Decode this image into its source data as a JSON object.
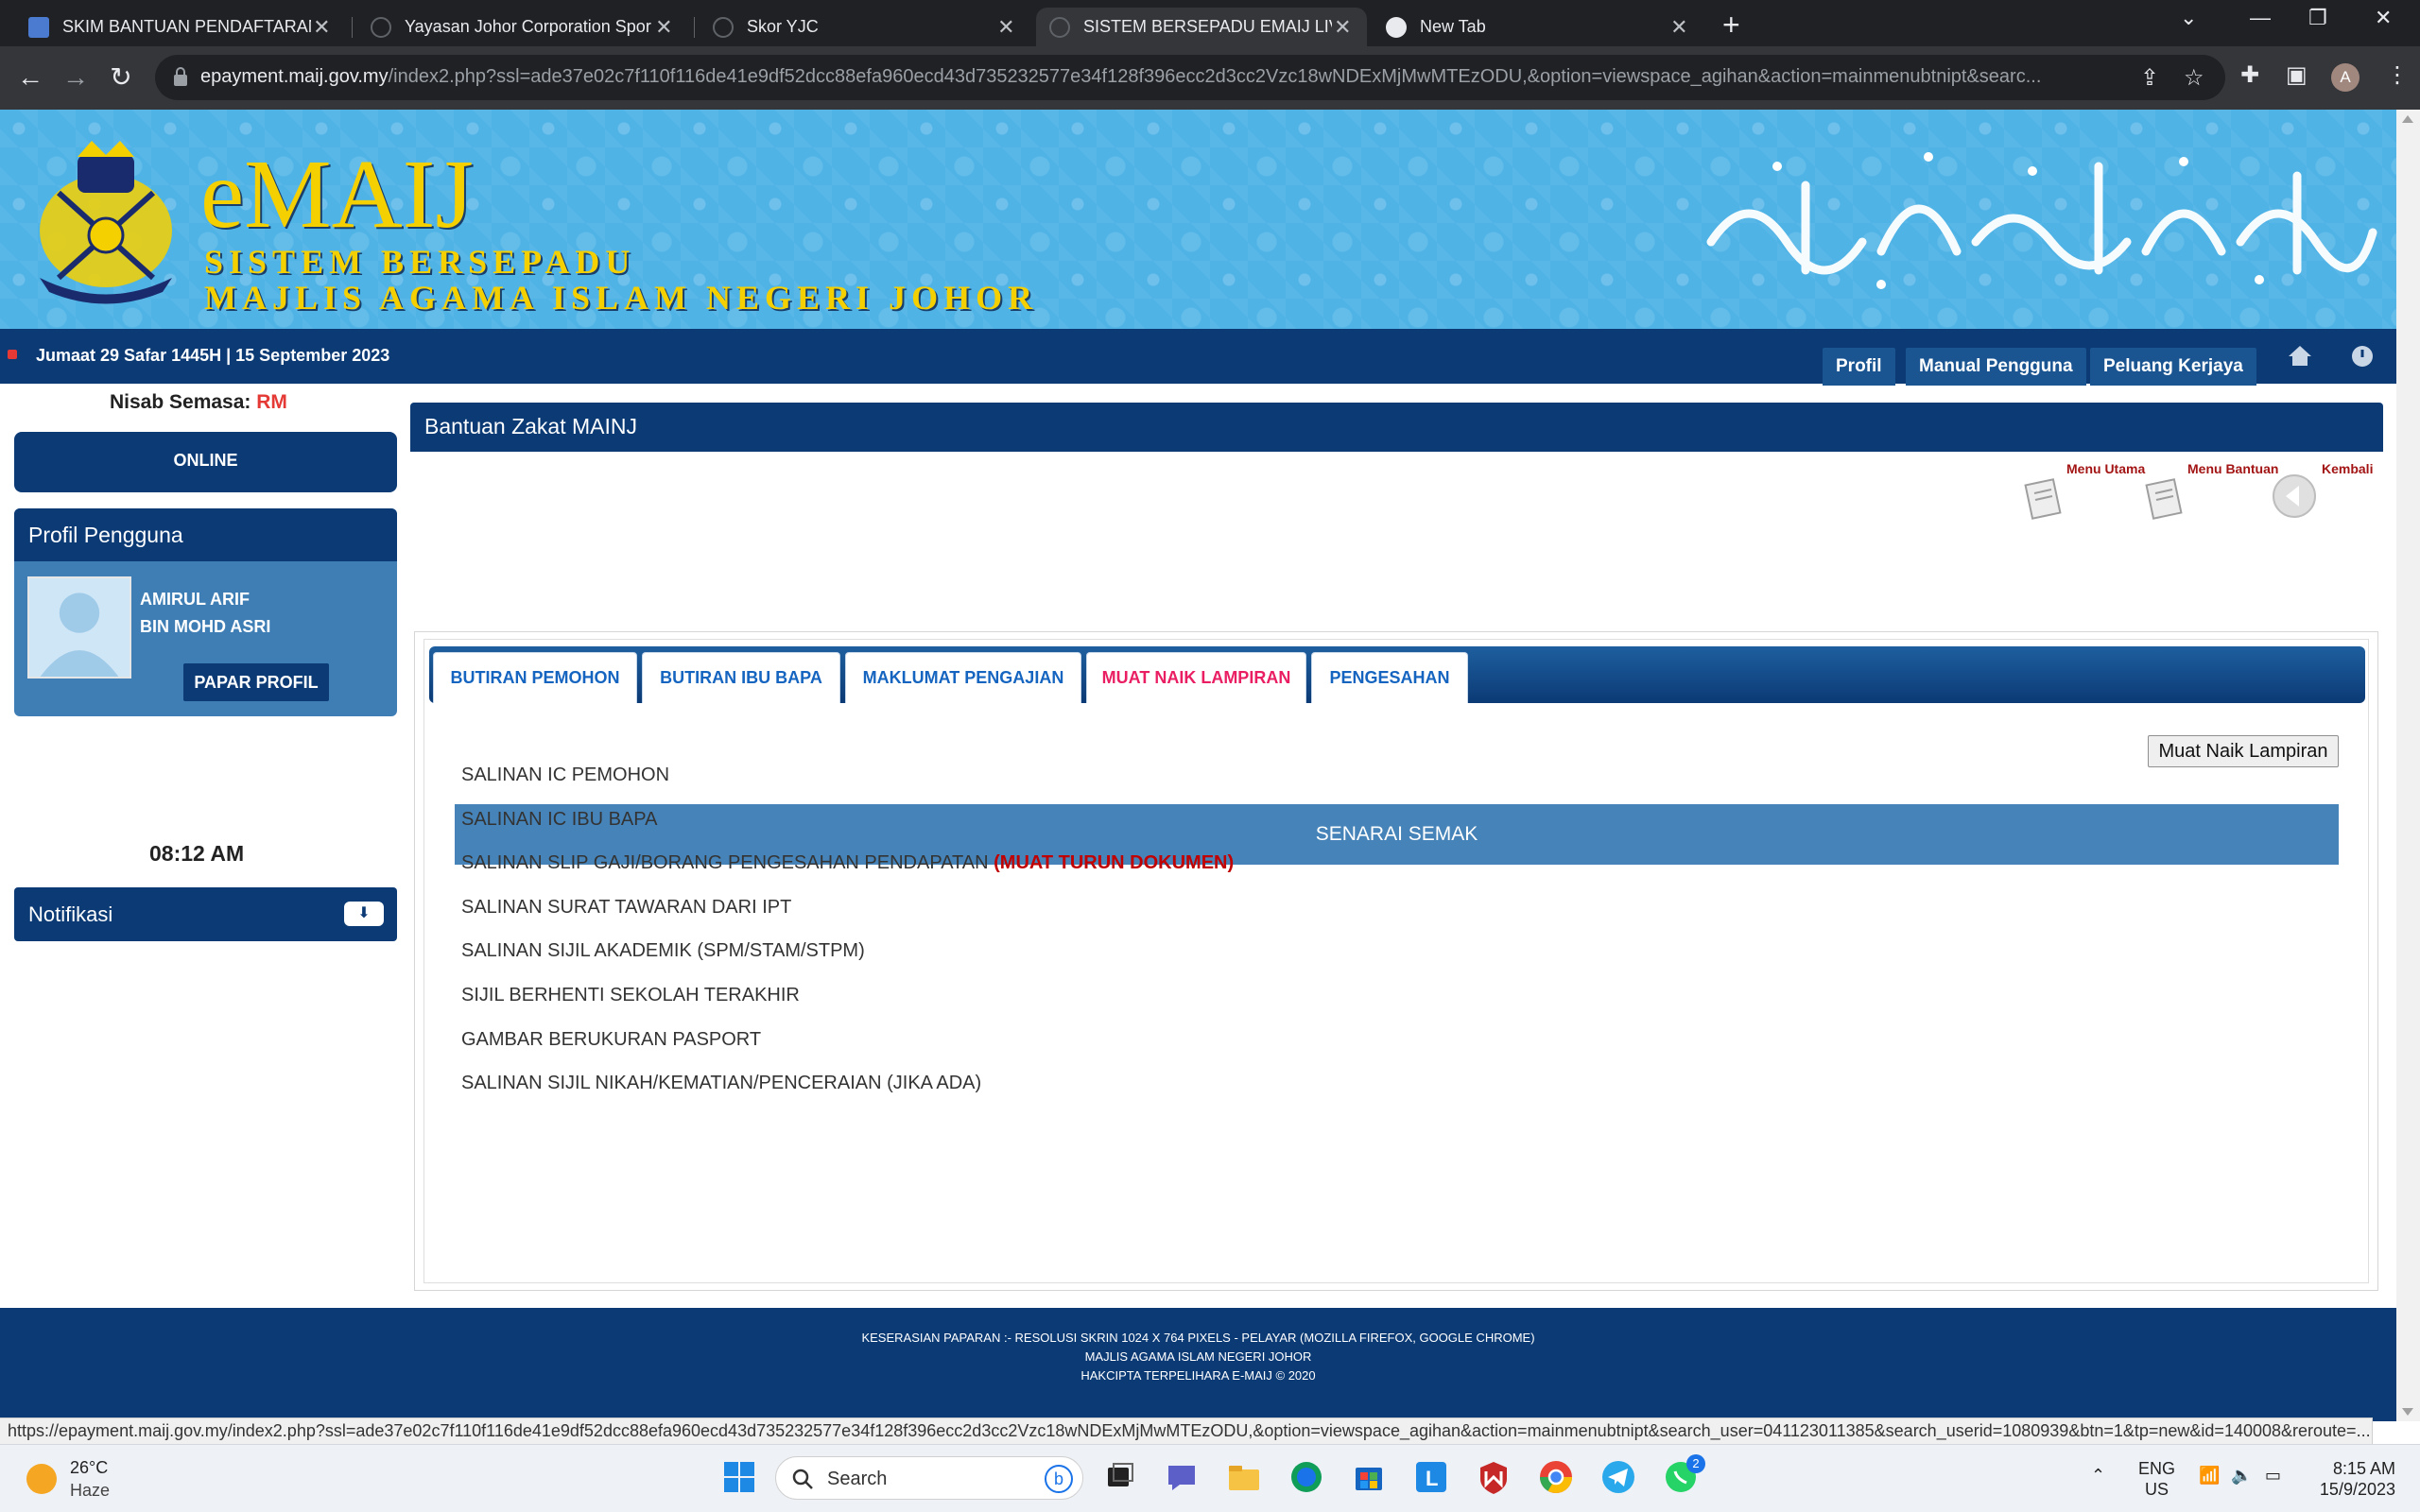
{
  "browser": {
    "tabs": [
      {
        "title": "SKIM BANTUAN PENDAFTARAN",
        "active": false
      },
      {
        "title": "Yayasan Johor Corporation Spor",
        "active": false
      },
      {
        "title": "Skor YJC",
        "active": false
      },
      {
        "title": "SISTEM BERSEPADU EMAIJ LIVE",
        "active": true
      },
      {
        "title": "New Tab",
        "active": false
      }
    ],
    "url_host": "epayment.maij.gov.my",
    "url_rest": "/index2.php?ssl=ade37e02c7f110f116de41e9df52dcc88efa960ecd43d735232577e34f128f396ecc2d3cc2Vzc18wNDExMjMwMTEzODU,&option=viewspace_agihan&action=mainmenubtnipt&searc...",
    "profile_initial": "A",
    "status_url": "https://epayment.maij.gov.my/index2.php?ssl=ade37e02c7f110f116de41e9df52dcc88efa960ecd43d735232577e34f128f396ecc2d3cc2Vzc18wNDExMjMwMTEzODU,&option=viewspace_agihan&action=mainmenubtnipt&search_user=041123011385&search_userid=1080939&btn=1&tp=new&id=140008&reroute=..."
  },
  "banner": {
    "logo_text": "eMAIJ",
    "line1": "SISTEM BERSEPADU",
    "line2": "MAJLIS AGAMA ISLAM NEGERI JOHOR"
  },
  "datebar": {
    "date": "Jumaat 29 Safar 1445H | 15 September 2023",
    "buttons": [
      "Profil",
      "Manual Pengguna",
      "Peluang Kerjaya"
    ]
  },
  "sidebar": {
    "nisab_label": "Nisab Semasa:",
    "nisab_value": "RM",
    "status": "ONLINE",
    "profile_title": "Profil Pengguna",
    "name_line1": "AMIRUL ARIF",
    "name_line2": "BIN MOHD ASRI",
    "profile_button": "PAPAR PROFIL",
    "time": "08:12 AM",
    "notif_title": "Notifikasi"
  },
  "main": {
    "title": "Bantuan Zakat MAINJ",
    "quick_links": [
      "Menu Utama",
      "Menu Bantuan",
      "Kembali"
    ],
    "tabs": [
      {
        "label": "BUTIRAN PEMOHON",
        "active": false
      },
      {
        "label": "BUTIRAN IBU BAPA",
        "active": false
      },
      {
        "label": "MAKLUMAT PENGAJIAN",
        "active": false
      },
      {
        "label": "MUAT NAIK LAMPIRAN",
        "active": true
      },
      {
        "label": "PENGESAHAN",
        "active": false
      }
    ],
    "upload_button": "Muat Naik Lampiran",
    "checklist_title": "SENARAI SEMAK",
    "checklist": [
      "SALINAN IC PEMOHON",
      "SALINAN IC IBU BAPA",
      "SALINAN SLIP GAJI/BORANG PENGESAHAN PENDAPATAN",
      "SALINAN SURAT TAWARAN DARI IPT",
      "SALINAN SIJIL AKADEMIK (SPM/STAM/STPM)",
      "SIJIL BERHENTI SEKOLAH TERAKHIR",
      "GAMBAR BERUKURAN PASPORT",
      "SALINAN SIJIL NIKAH/KEMATIAN/PENCERAIAN (JIKA ADA)"
    ],
    "download_link": "(MUAT TURUN DOKUMEN)"
  },
  "footer": {
    "line1": "KESERASIAN PAPARAN :- RESOLUSI SKRIN 1024 X 764 PIXELS - PELAYAR (MOZILLA FIREFOX, GOOGLE CHROME)",
    "line2": "MAJLIS AGAMA ISLAM NEGERI JOHOR",
    "line3": "HAKCIPTA TERPELIHARA E-MAIJ © 2020"
  },
  "taskbar": {
    "temperature": "26°C",
    "weather": "Haze",
    "search_label": "Search",
    "lang1": "ENG",
    "lang2": "US",
    "time": "8:15 AM",
    "date": "15/9/2023",
    "whatsapp_badge": "2"
  },
  "colors": {
    "navy": "#0b3a75",
    "banner_blue": "#4fb3e6",
    "gold": "#f5d000",
    "active_tab_pink": "#e91e63",
    "download_red": "#c00000"
  }
}
